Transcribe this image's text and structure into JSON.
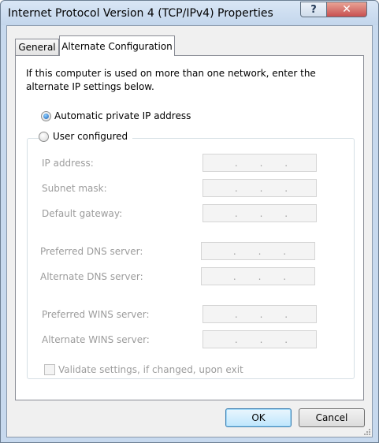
{
  "window": {
    "title": "Internet Protocol Version 4 (TCP/IPv4) Properties",
    "help_glyph": "?",
    "close_glyph": "✕"
  },
  "tabs": [
    {
      "label": "General",
      "selected": false
    },
    {
      "label": "Alternate Configuration",
      "selected": true
    }
  ],
  "description": "If this computer is used on more than one network, enter the alternate IP settings below.",
  "options": {
    "automatic": {
      "label": "Automatic private IP address",
      "checked": true
    },
    "user_configured": {
      "label": "User configured",
      "checked": false
    }
  },
  "fields": {
    "ip_address": {
      "label": "IP address:",
      "dots": ".  .  ."
    },
    "subnet_mask": {
      "label": "Subnet mask:"
    },
    "default_gateway": {
      "label": "Default gateway:"
    },
    "preferred_dns": {
      "label": "Preferred DNS server:"
    },
    "alternate_dns": {
      "label": "Alternate DNS server:"
    },
    "preferred_wins": {
      "label": "Preferred WINS server:"
    },
    "alternate_wins": {
      "label": "Alternate WINS server:"
    }
  },
  "validate": {
    "label": "Validate settings, if changed, upon exit",
    "checked": false
  },
  "buttons": {
    "ok": "OK",
    "cancel": "Cancel"
  },
  "colors": {
    "accent": "#3c7fb1",
    "disabled_text": "#9c9c9c"
  }
}
